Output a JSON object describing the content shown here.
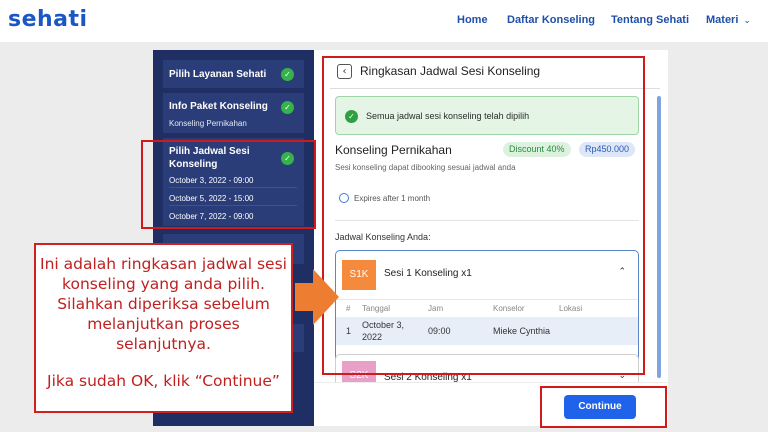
{
  "header": {
    "logo": "sehati",
    "nav": [
      "Home",
      "Daftar Konseling",
      "Tentang Sehati",
      "Materi"
    ]
  },
  "sidebar": {
    "items": [
      {
        "title": "Pilih Layanan Sehati",
        "done": true
      },
      {
        "title": "Info Paket Konseling",
        "subtitle": "Konseling Pernikahan",
        "done": true
      },
      {
        "title_line1": "Pilih Jadwal Sesi",
        "title_line2": "Konseling",
        "dates": [
          "October 3, 2022 - 09:00",
          "October 5, 2022 - 15:00",
          "October 7, 2022 - 09:00"
        ],
        "done": true
      }
    ]
  },
  "main": {
    "title": "Ringkasan Jadwal Sesi Konseling",
    "success_message": "Semua jadwal sesi konseling telah dipilih",
    "package": {
      "name": "Konseling Pernikahan",
      "discount": "Discount 40%",
      "price": "Rp450.000",
      "description": "Sesi konseling dapat dibooking sesuai jadwal anda",
      "expires": "Expires after 1 month"
    },
    "schedule_label": "Jadwal Konseling Anda:",
    "sessions": [
      {
        "code": "S1K",
        "label": "Sesi 1 Konseling x1",
        "expanded": true,
        "columns": [
          "#",
          "Tanggal",
          "Jam",
          "Konselor",
          "Lokasi"
        ],
        "rows": [
          {
            "no": "1",
            "date_line1": "October 3,",
            "date_line2": "2022",
            "time": "09:00",
            "counselor": "Mieke Cynthia",
            "location": ""
          }
        ]
      },
      {
        "code": "S2K",
        "label": "Sesi 2 Konseling x1",
        "expanded": false
      }
    ],
    "continue_label": "Continue"
  },
  "callout": {
    "lines": [
      "Ini adalah ringkasan jadwal sesi",
      "konseling yang anda pilih.",
      "Silahkan diperiksa sebelum",
      "melanjutkan proses",
      "selanjutnya."
    ],
    "last_line": "Jika sudah OK, klik “Continue”"
  },
  "colors": {
    "brand": "#1a56c4",
    "sidebar_bg": "#1f2f63",
    "primary_button": "#1e63e9",
    "success": "#2ea043",
    "annotation_red": "#d11a1a",
    "arrow_orange": "#ed7d31"
  }
}
